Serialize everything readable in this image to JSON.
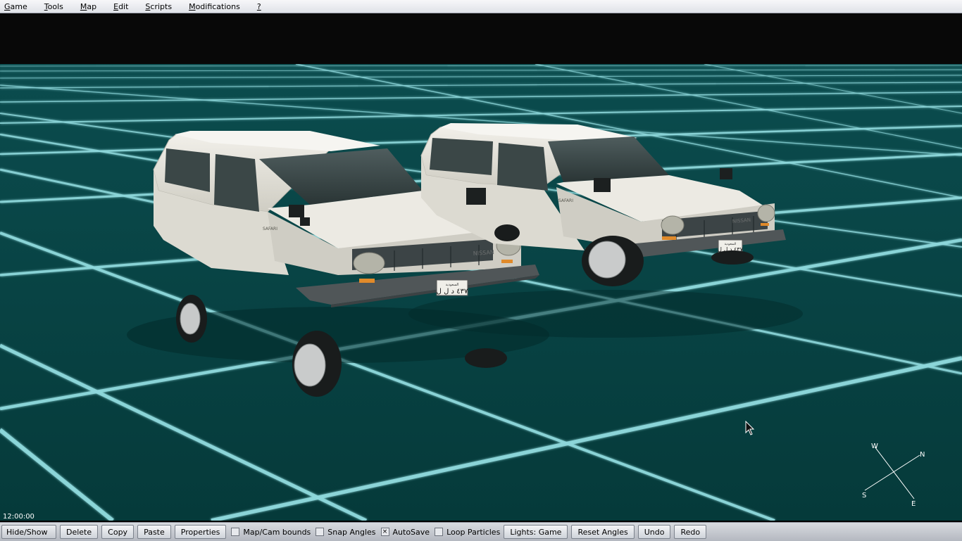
{
  "menu": {
    "items": [
      {
        "label": "Game",
        "underline_index": 0
      },
      {
        "label": "Tools",
        "underline_index": 0
      },
      {
        "label": "Map",
        "underline_index": 0
      },
      {
        "label": "Edit",
        "underline_index": 0
      },
      {
        "label": "Scripts",
        "underline_index": 0
      },
      {
        "label": "Modifications",
        "underline_index": 0
      },
      {
        "label": "?",
        "underline_index": 0
      }
    ]
  },
  "viewport": {
    "time": "12:00:00",
    "grid_color": "#8ed8dc",
    "ground_color": "#073f3f",
    "vehicles": [
      {
        "brand": "NISSAN",
        "model_badge": "SAFARI",
        "plate": "٤٣٧ د ل ل",
        "plate_top": "السعودية",
        "color": "#e4e2d8"
      },
      {
        "brand": "NISSAN",
        "model_badge": "SAFARI",
        "plate": "٤٣٧ د ل ل",
        "plate_top": "السعودية",
        "color": "#e4e2d8"
      }
    ]
  },
  "compass": {
    "w": "W",
    "n": "N",
    "s": "S",
    "e": "E"
  },
  "toolbar": {
    "hide_show": "Hide/Show",
    "delete": "Delete",
    "copy": "Copy",
    "paste": "Paste",
    "properties": "Properties",
    "map_cam_bounds": "Map/Cam bounds",
    "map_cam_bounds_checked": false,
    "snap_angles": "Snap Angles",
    "snap_angles_checked": false,
    "autosave": "AutoSave",
    "autosave_checked": true,
    "loop_particles": "Loop Particles",
    "loop_particles_checked": false,
    "lights": "Lights: Game",
    "reset_angles": "Reset Angles",
    "undo": "Undo",
    "redo": "Redo"
  }
}
